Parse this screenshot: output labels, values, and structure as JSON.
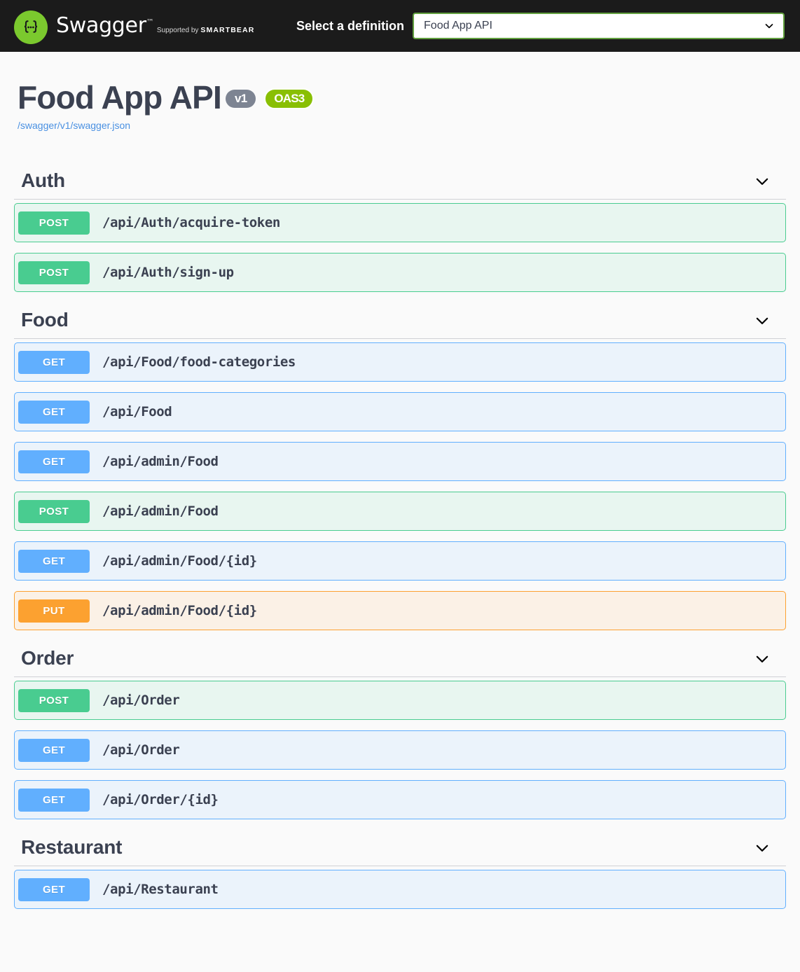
{
  "topbar": {
    "logo_icon": "swagger-braces-logo",
    "brand_title": "Swagger",
    "brand_trademark": "™",
    "brand_supported_prefix": "Supported by",
    "brand_supported_company": "SMARTBEAR",
    "definition_label": "Select a definition",
    "definition_selected": "Food App API",
    "definition_options": [
      "Food App API"
    ],
    "caret_icon": "chevron-down-icon"
  },
  "info": {
    "title": "Food App API",
    "version_badge": "v1",
    "oas_badge": "OAS3",
    "spec_url": "/swagger/v1/swagger.json"
  },
  "colors": {
    "topbar_bg": "#1b1b1b",
    "page_bg": "#fafafa",
    "logo_green": "#7bc92e",
    "select_border_green": "#62a03f",
    "oas_badge_green": "#89bf04",
    "version_badge_gray": "#7d8492",
    "link_blue": "#4990e2",
    "text_dark": "#3b4151",
    "get": "#61affe",
    "get_bg": "#ebf3fb",
    "post": "#49cc90",
    "post_bg": "#e8f6f0",
    "put": "#fca130",
    "put_bg": "#fbf1e6"
  },
  "tags": [
    {
      "name": "Auth",
      "caret_icon": "chevron-down-icon",
      "operations": [
        {
          "method": "POST",
          "method_class": "post",
          "path": "/api/Auth/acquire-token"
        },
        {
          "method": "POST",
          "method_class": "post",
          "path": "/api/Auth/sign-up"
        }
      ]
    },
    {
      "name": "Food",
      "caret_icon": "chevron-down-icon",
      "operations": [
        {
          "method": "GET",
          "method_class": "get",
          "path": "/api/Food/food-categories"
        },
        {
          "method": "GET",
          "method_class": "get",
          "path": "/api/Food"
        },
        {
          "method": "GET",
          "method_class": "get",
          "path": "/api/admin/Food"
        },
        {
          "method": "POST",
          "method_class": "post",
          "path": "/api/admin/Food"
        },
        {
          "method": "GET",
          "method_class": "get",
          "path": "/api/admin/Food/{id}"
        },
        {
          "method": "PUT",
          "method_class": "put",
          "path": "/api/admin/Food/{id}"
        }
      ]
    },
    {
      "name": "Order",
      "caret_icon": "chevron-down-icon",
      "operations": [
        {
          "method": "POST",
          "method_class": "post",
          "path": "/api/Order"
        },
        {
          "method": "GET",
          "method_class": "get",
          "path": "/api/Order"
        },
        {
          "method": "GET",
          "method_class": "get",
          "path": "/api/Order/{id}"
        }
      ]
    },
    {
      "name": "Restaurant",
      "caret_icon": "chevron-down-icon",
      "operations": [
        {
          "method": "GET",
          "method_class": "get",
          "path": "/api/Restaurant"
        }
      ]
    }
  ]
}
